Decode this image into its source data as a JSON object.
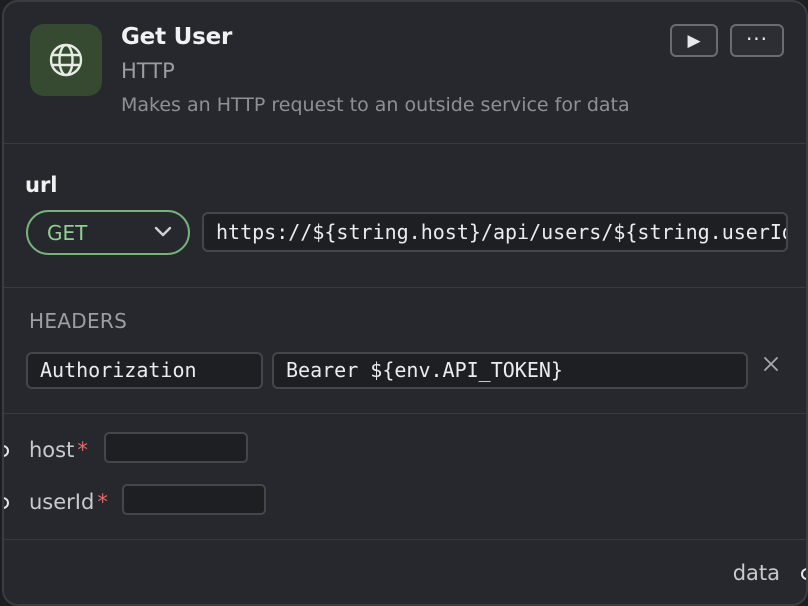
{
  "node": {
    "title": "Get User",
    "type": "HTTP",
    "description": "Makes an HTTP request to an outside service for data",
    "icon": "globe-icon",
    "icon_bg": "#354a31",
    "run_glyph": "▶",
    "more_glyph": "···"
  },
  "url": {
    "label": "url",
    "method": "GET",
    "method_color": "#77b27c",
    "value": "https://${string.host}/api/users/${string.userId}"
  },
  "headers": {
    "label": "HEADERS",
    "items": [
      {
        "key": "Authorization",
        "value": "Bearer ${env.API_TOKEN}"
      }
    ]
  },
  "inputs": [
    {
      "name": "host",
      "required_mark": "*",
      "value": ""
    },
    {
      "name": "userId",
      "required_mark": "*",
      "value": ""
    }
  ],
  "outputs": [
    {
      "name": "data"
    }
  ]
}
